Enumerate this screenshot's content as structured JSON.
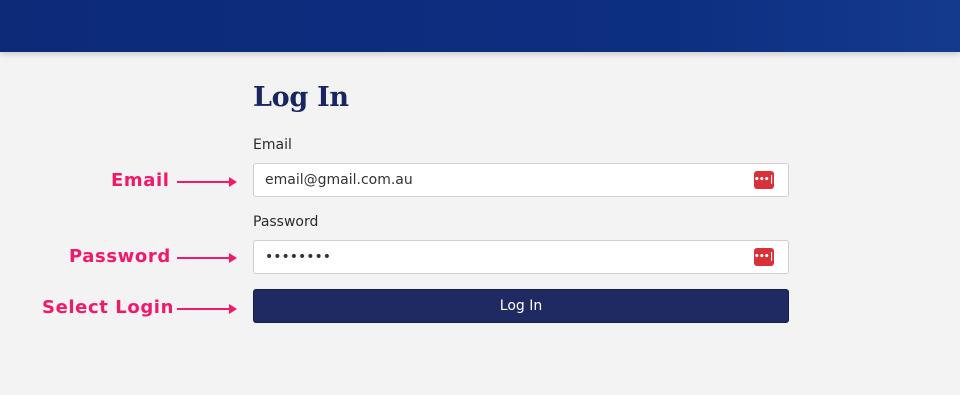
{
  "header": {
    "color": "#0c2a78"
  },
  "form": {
    "title": "Log In",
    "email_label": "Email",
    "email_value": "email@gmail.com.au",
    "password_label": "Password",
    "password_value": "••••••••",
    "password_manager_icon": "password-manager-icon",
    "password_manager_glyph": "•••|",
    "submit_label": "Log In",
    "button_color": "#1f2a62"
  },
  "annotations": {
    "email": "Email",
    "password": "Password",
    "login": "Select Login",
    "color": "#f0196b"
  }
}
